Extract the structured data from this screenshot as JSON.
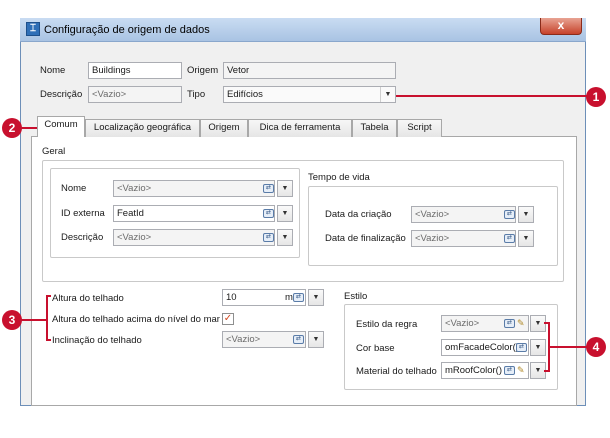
{
  "window": {
    "title": "Configuração de origem de dados",
    "close_glyph": "x"
  },
  "top_fields": {
    "name_label": "Nome",
    "name_value": "Buildings",
    "origin_label": "Origem",
    "origin_value": "Vetor",
    "description_label": "Descrição",
    "description_value": "<Vazio>",
    "type_label": "Tipo",
    "type_value": "Edifícios"
  },
  "tabs": [
    {
      "label": "Comum",
      "active": true
    },
    {
      "label": "Localização geográfica",
      "active": false
    },
    {
      "label": "Origem",
      "active": false
    },
    {
      "label": "Dica de ferramenta",
      "active": false
    },
    {
      "label": "Tabela",
      "active": false
    },
    {
      "label": "Script",
      "active": false
    }
  ],
  "geral": {
    "title": "Geral",
    "nome_label": "Nome",
    "nome_value": "<Vazio>",
    "id_label": "ID externa",
    "id_value": "FeatId",
    "desc_label": "Descrição",
    "desc_value": "<Vazio>"
  },
  "tempo_de_vida": {
    "title": "Tempo de vida",
    "criacao_label": "Data da criação",
    "criacao_value": "<Vazio>",
    "finalizacao_label": "Data de finalização",
    "finalizacao_value": "<Vazio>"
  },
  "telhado": {
    "altura_label": "Altura do telhado",
    "altura_value": "10",
    "altura_unit": "m",
    "acima_label": "Altura do telhado acima do nível do mar",
    "acima_checked": true,
    "inclinacao_label": "Inclinação do telhado",
    "inclinacao_value": "<Vazio>"
  },
  "estilo": {
    "title": "Estilo",
    "regra_label": "Estilo da regra",
    "regra_value": "<Vazio>",
    "cor_label": "Cor base",
    "cor_value": "omFacadeColor()",
    "material_label": "Material do telhado",
    "material_value": "mRoofColor()"
  },
  "callouts": [
    "1",
    "2",
    "3",
    "4"
  ],
  "icons": {
    "binding": "link-binding-icon",
    "edit": "pencil-icon",
    "dropdown": "chevron-down-icon",
    "check": "checkmark-icon"
  },
  "colors": {
    "callout": "#c8102e",
    "titlebar": "#b9d1ea",
    "close": "#c7422a"
  }
}
